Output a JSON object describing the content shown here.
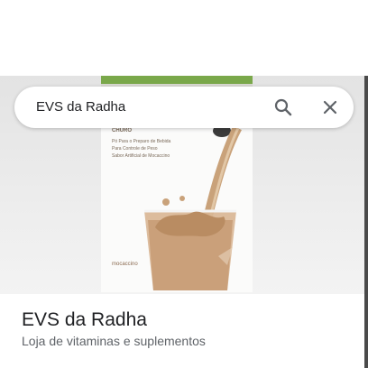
{
  "search": {
    "query": "EVS da Radha",
    "search_icon": "search-icon",
    "close_icon": "close-icon"
  },
  "place": {
    "name": "EVS da Radha",
    "category": "Loja de vitaminas e suplementos"
  },
  "photo": {
    "can_text": [
      "CHURO",
      "Pó Para o Preparo de Bebida",
      "Para Controle de Peso",
      "Sabor Artificial de Mocaccino"
    ],
    "flavor": "mocaccino"
  },
  "colors": {
    "accent_green": "#7aa84a",
    "shake": "#c9a27a",
    "text_primary": "#202124",
    "text_secondary": "#5f6368"
  }
}
